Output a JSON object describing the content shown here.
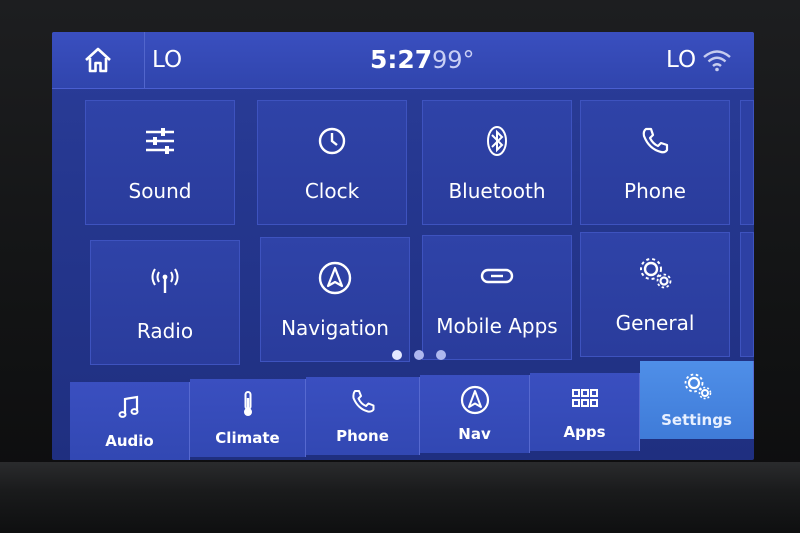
{
  "status_bar": {
    "left_temp": "LO",
    "time": "5:27",
    "outside_temp": "99°",
    "right_temp": "LO",
    "icons": [
      "home-icon",
      "wifi-icon"
    ]
  },
  "settings_tiles": [
    {
      "label": "Sound",
      "icon": "equalizer-icon"
    },
    {
      "label": "Clock",
      "icon": "clock-icon"
    },
    {
      "label": "Bluetooth",
      "icon": "bluetooth-icon"
    },
    {
      "label": "Phone",
      "icon": "phone-icon"
    },
    {
      "label": "Radio",
      "icon": "radio-antenna-icon"
    },
    {
      "label": "Navigation",
      "icon": "navigation-arrow-icon"
    },
    {
      "label": "Mobile Apps",
      "icon": "link-icon"
    },
    {
      "label": "General",
      "icon": "gears-icon"
    }
  ],
  "pagination": {
    "pages": 3,
    "current": 1
  },
  "nav_bar": [
    {
      "label": "Audio",
      "icon": "music-note-icon",
      "selected": false
    },
    {
      "label": "Climate",
      "icon": "thermometer-icon",
      "selected": false
    },
    {
      "label": "Phone",
      "icon": "phone-icon",
      "selected": false
    },
    {
      "label": "Nav",
      "icon": "navigation-arrow-icon",
      "selected": false
    },
    {
      "label": "Apps",
      "icon": "apps-grid-icon",
      "selected": false
    },
    {
      "label": "Settings",
      "icon": "gears-icon",
      "selected": true
    }
  ],
  "colors": {
    "screen_bg": "#25378f",
    "tile_bg": "#2f43a8",
    "nav_bg": "#3a4fc0",
    "nav_selected": "#4f8fe8"
  }
}
